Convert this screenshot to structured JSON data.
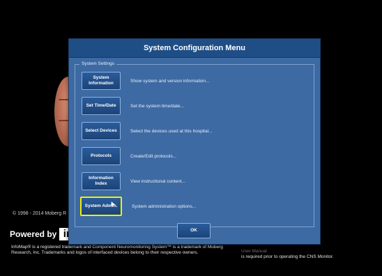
{
  "dialog": {
    "title": "System Configuration Menu",
    "group_label": "System Settings",
    "rows": [
      {
        "button": "System\nInformation",
        "description": "Show system and version information..."
      },
      {
        "button": "Set Time/Date",
        "description": "Set the system time/date..."
      },
      {
        "button": "Select Devices",
        "description": "Select the devices used at this hospital..."
      },
      {
        "button": "Protocols",
        "description": "Create/Edit protocols..."
      },
      {
        "button": "Information\nIndex",
        "description": "View instructional content..."
      },
      {
        "button": "System Admin.",
        "description": "System administration options..."
      }
    ],
    "ok_label": "OK"
  },
  "footer": {
    "copyright": "© 1998 - 2014 Moberg R",
    "powered_by": "Powered by",
    "logo_text": "in",
    "legal": "InfoMap® is a registered trademark and Component Neuromonitoring System™ is a trademark of Moberg Research, Inc. Trademarks and logos of interfaced devices belong to their respective owners.",
    "notice_partial": "User Manual",
    "notice": "is required prior to operating the CNS Monitor."
  },
  "colors": {
    "dialog_bg": "#3d6aa3",
    "title_bar": "#1f4e86",
    "selected_outline": "#f0f000"
  }
}
